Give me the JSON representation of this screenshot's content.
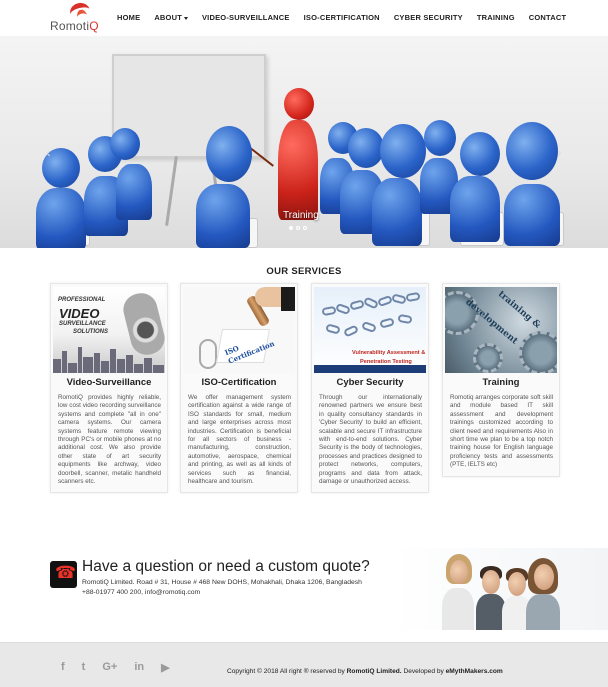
{
  "brand": {
    "logo_prefix": "Romoti",
    "logo_suffix": "Q"
  },
  "nav": {
    "items": [
      "HOME",
      "ABOUT",
      "VIDEO-SURVEILLANCE",
      "ISO-CERTIFICATION",
      "CYBER SECURITY",
      "TRAINING",
      "CONTACT"
    ]
  },
  "hero": {
    "caption": "Training",
    "prev_icon": "chevron-left-icon",
    "next_icon": "chevron-right-icon",
    "slides_count": 3,
    "active_slide": 1
  },
  "services": {
    "title": "OUR SERVICES",
    "cards": [
      {
        "title": "Video-Surveillance",
        "image_text": [
          "PROFESSIONAL",
          "VIDEO",
          "SURVEILLANCE",
          "SOLUTIONS"
        ],
        "text": "RomotiQ provides highly reliable, low cost video recording surveillance systems and complete \"all in one\" camera systems. Our camera systems feature remote viewing through PC's or mobile phones at no additional cost. We also provide other state of art security equipments like archway, video doorbell, scanner, metalic handheld scanners etc."
      },
      {
        "title": "ISO-Certification",
        "image_text": [
          "ISO",
          "Certification"
        ],
        "text": "We offer management system certification against a wide range of ISO standards for small, medium and large enterprises across most industries. Certification is beneficial for all sectors of business - manufacturing, construction, automotive, aerospace, chemical and printing, as well as all kinds of services such as financial, healthcare and tourism."
      },
      {
        "title": "Cyber Security",
        "image_text": [
          "Vulnerability Assessment &",
          "Penetration Testing"
        ],
        "text": "Through our internationally renowned partners we ensure best in quality consultancy standards in 'Cyber Security' to build an efficient, scalable and secure IT infrastructure with end-to-end solutions. Cyber Security is the body of technologies, processes and practices designed to protect networks, computers, programs and data from attack, damage or unauthorized access."
      },
      {
        "title": "Training",
        "image_text": [
          "training &",
          "development"
        ],
        "text": "Romotiq arranges corporate soft skill and module based IT skill assessment and development trainings customized according to client need and requirements Also in short time we plan to be a top notch training house for English language proficiency tests and assessments (PTE, IELTS etc)"
      }
    ]
  },
  "cta": {
    "title": "Have a question or need a custom quote?",
    "address": "RomotiQ Limited. Road # 31, House # 468 New DOHS, Mohakhali, Dhaka 1206, Bangladesh",
    "contact": "+88-01977 400 200, info@romotiq.com",
    "icon": "phone-icon"
  },
  "footer": {
    "social": [
      {
        "name": "facebook-icon",
        "glyph": "f"
      },
      {
        "name": "twitter-icon",
        "glyph": "t"
      },
      {
        "name": "google-plus-icon",
        "glyph": "G+"
      },
      {
        "name": "linkedin-icon",
        "glyph": "in"
      },
      {
        "name": "youtube-icon",
        "glyph": "▶"
      }
    ],
    "copyright_prefix": "Copyright © 2018 All right ® reserved by ",
    "copyright_company": "RomotiQ Limited.",
    "copyright_mid": " Developed by ",
    "copyright_dev": "eMythMakers.com"
  },
  "colors": {
    "accent": "#d9302b",
    "hero_figure": "#2a63c9",
    "teacher": "#d3251c",
    "footer_bg": "#e8e8e8"
  }
}
